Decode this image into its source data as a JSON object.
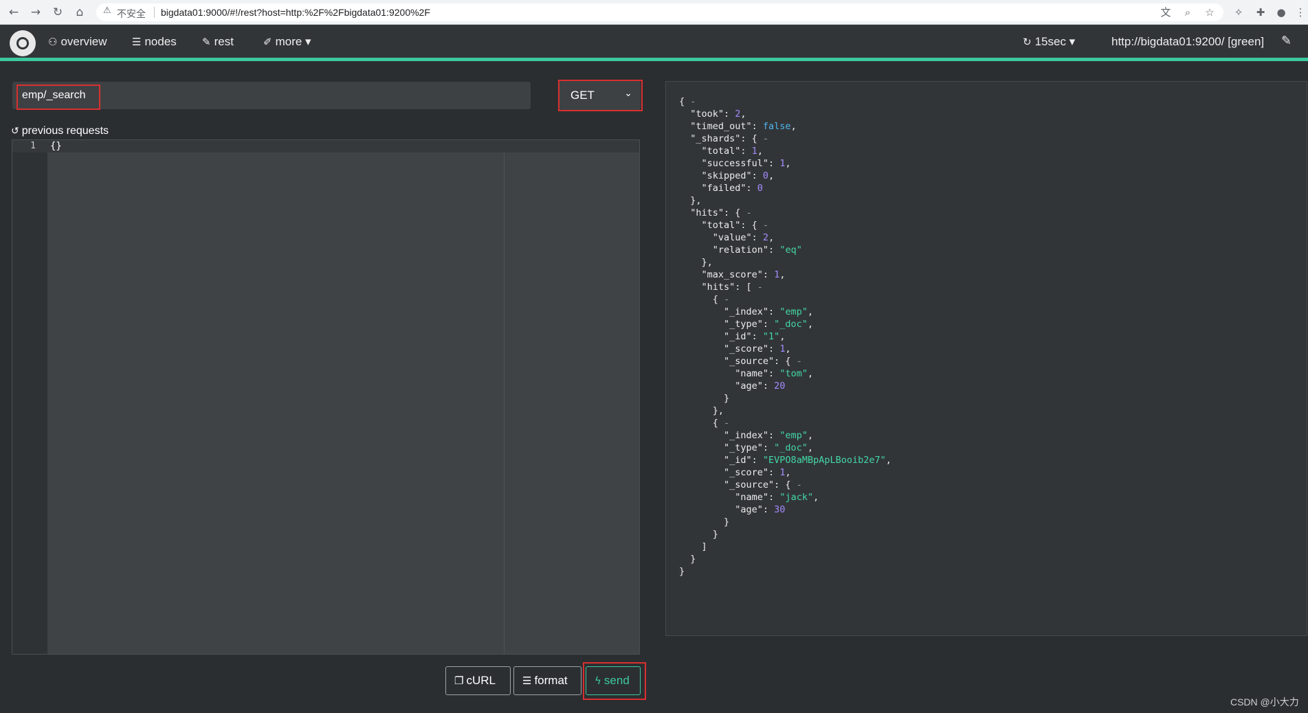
{
  "browser": {
    "back_icon": "←",
    "forward_icon": "→",
    "reload_icon": "↻",
    "home_icon": "⌂",
    "warning_icon": "⚠",
    "insecure_label": "不安全",
    "url": "bigdata01:9000/#!/rest?host=http:%2F%2Fbigdata01:9200%2F",
    "translate_icon": "文",
    "zoom_icon": "⌕",
    "star_icon": "☆",
    "extension_icon": "✧",
    "puzzle_icon": "✚",
    "profile_icon": "●",
    "menu_icon": "⋮"
  },
  "header": {
    "nav": [
      {
        "icon": "⚇",
        "label": "overview"
      },
      {
        "icon": "☰",
        "label": "nodes"
      },
      {
        "icon": "✎",
        "label": "rest"
      },
      {
        "icon": "✐",
        "label": "more ▾"
      }
    ],
    "refresh_icon": "↻",
    "refresh_label": "15sec ▾",
    "cluster_label": "http://bigdata01:9200/ [green]",
    "plug_icon": "✎"
  },
  "request": {
    "path": "emp/_search",
    "method": "GET",
    "method_chevron": "⌄",
    "previous_icon": "↺",
    "previous_label": "previous requests",
    "line_number": "1",
    "body": "{}"
  },
  "buttons": {
    "curl_icon": "❐",
    "curl": "cURL",
    "format_icon": "☰",
    "format": "format",
    "send_icon": "ϟ",
    "send": "send"
  },
  "response": {
    "collapse": "-",
    "took": "2",
    "timed_out": "false",
    "shards": {
      "total": "1",
      "successful": "1",
      "skipped": "0",
      "failed": "0"
    },
    "hits_total": {
      "value": "2",
      "relation": "\"eq\""
    },
    "max_score": "1",
    "docs": [
      {
        "index": "\"emp\"",
        "type": "\"_doc\"",
        "id": "\"1\"",
        "score": "1",
        "name": "\"tom\"",
        "age": "20"
      },
      {
        "index": "\"emp\"",
        "type": "\"_doc\"",
        "id": "\"EVPO8aMBpApLBooib2e7\"",
        "score": "1",
        "name": "\"jack\"",
        "age": "30"
      }
    ]
  },
  "watermark": "CSDN @小大力"
}
